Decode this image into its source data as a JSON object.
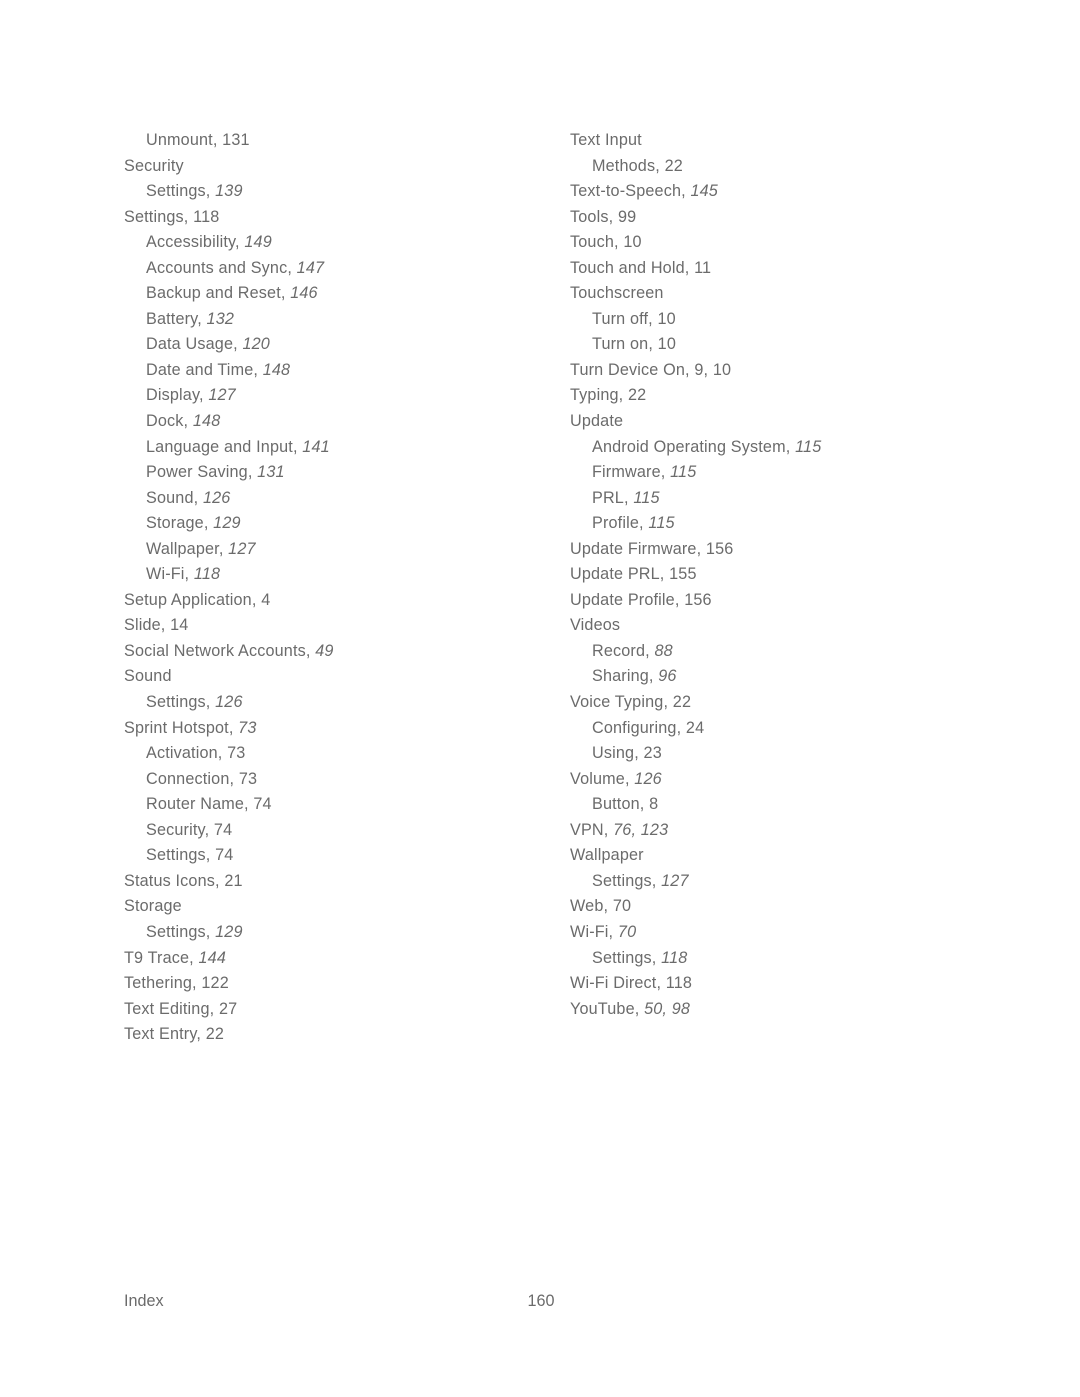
{
  "document": {
    "type": "book-index",
    "page_number": "160",
    "footer_label": "Index"
  },
  "columns": {
    "left": {
      "entries": [
        {
          "level": 1,
          "term": "Unmount,",
          "locator": "131",
          "italic": false
        },
        {
          "level": 0,
          "term": "Security",
          "locator": "",
          "italic": false
        },
        {
          "level": 1,
          "term": "Settings,",
          "locator": "139",
          "italic": true
        },
        {
          "level": 0,
          "term": "Settings,",
          "locator": "118",
          "italic": false
        },
        {
          "level": 1,
          "term": "Accessibility,",
          "locator": "149",
          "italic": true
        },
        {
          "level": 1,
          "term": "Accounts and Sync,",
          "locator": "147",
          "italic": true
        },
        {
          "level": 1,
          "term": "Backup and Reset,",
          "locator": "146",
          "italic": true
        },
        {
          "level": 1,
          "term": "Battery,",
          "locator": "132",
          "italic": true
        },
        {
          "level": 1,
          "term": "Data Usage,",
          "locator": "120",
          "italic": true
        },
        {
          "level": 1,
          "term": "Date and Time,",
          "locator": "148",
          "italic": true
        },
        {
          "level": 1,
          "term": "Display,",
          "locator": "127",
          "italic": true
        },
        {
          "level": 1,
          "term": "Dock,",
          "locator": "148",
          "italic": true
        },
        {
          "level": 1,
          "term": "Language and Input,",
          "locator": "141",
          "italic": true
        },
        {
          "level": 1,
          "term": "Power Saving,",
          "locator": "131",
          "italic": true
        },
        {
          "level": 1,
          "term": "Sound,",
          "locator": "126",
          "italic": true
        },
        {
          "level": 1,
          "term": "Storage,",
          "locator": "129",
          "italic": true
        },
        {
          "level": 1,
          "term": "Wallpaper,",
          "locator": "127",
          "italic": true
        },
        {
          "level": 1,
          "term": "Wi-Fi,",
          "locator": "118",
          "italic": true
        },
        {
          "level": 0,
          "term": "Setup Application,",
          "locator": "4",
          "italic": false
        },
        {
          "level": 0,
          "term": "Slide,",
          "locator": "14",
          "italic": false
        },
        {
          "level": 0,
          "term": "Social Network Accounts,",
          "locator": "49",
          "italic": true
        },
        {
          "level": 0,
          "term": "Sound",
          "locator": "",
          "italic": false
        },
        {
          "level": 1,
          "term": "Settings,",
          "locator": "126",
          "italic": true
        },
        {
          "level": 0,
          "term": "Sprint Hotspot,",
          "locator": "73",
          "italic": true
        },
        {
          "level": 1,
          "term": "Activation,",
          "locator": "73",
          "italic": false
        },
        {
          "level": 1,
          "term": "Connection,",
          "locator": "73",
          "italic": false
        },
        {
          "level": 1,
          "term": "Router Name,",
          "locator": "74",
          "italic": false
        },
        {
          "level": 1,
          "term": "Security,",
          "locator": "74",
          "italic": false
        },
        {
          "level": 1,
          "term": "Settings,",
          "locator": "74",
          "italic": false
        },
        {
          "level": 0,
          "term": "Status Icons,",
          "locator": "21",
          "italic": false
        },
        {
          "level": 0,
          "term": "Storage",
          "locator": "",
          "italic": false
        },
        {
          "level": 1,
          "term": "Settings,",
          "locator": "129",
          "italic": true
        },
        {
          "level": 0,
          "term": "T9 Trace,",
          "locator": "144",
          "italic": true
        },
        {
          "level": 0,
          "term": "Tethering,",
          "locator": "122",
          "italic": false
        },
        {
          "level": 0,
          "term": "Text Editing,",
          "locator": "27",
          "italic": false
        },
        {
          "level": 0,
          "term": "Text Entry,",
          "locator": "22",
          "italic": false
        }
      ]
    },
    "right": {
      "entries": [
        {
          "level": 0,
          "term": "Text Input",
          "locator": "",
          "italic": false
        },
        {
          "level": 1,
          "term": "Methods,",
          "locator": "22",
          "italic": false
        },
        {
          "level": 0,
          "term": "Text-to-Speech,",
          "locator": "145",
          "italic": true
        },
        {
          "level": 0,
          "term": "Tools,",
          "locator": "99",
          "italic": false
        },
        {
          "level": 0,
          "term": "Touch,",
          "locator": "10",
          "italic": false
        },
        {
          "level": 0,
          "term": "Touch and Hold,",
          "locator": "11",
          "italic": false
        },
        {
          "level": 0,
          "term": "Touchscreen",
          "locator": "",
          "italic": false
        },
        {
          "level": 1,
          "term": "Turn off,",
          "locator": "10",
          "italic": false
        },
        {
          "level": 1,
          "term": "Turn on,",
          "locator": "10",
          "italic": false
        },
        {
          "level": 0,
          "term": "Turn Device On,",
          "locator": "9, 10",
          "italic": false
        },
        {
          "level": 0,
          "term": "Typing,",
          "locator": "22",
          "italic": false
        },
        {
          "level": 0,
          "term": "Update",
          "locator": "",
          "italic": false
        },
        {
          "level": 1,
          "term": "Android Operating System,",
          "locator": "115",
          "italic": true
        },
        {
          "level": 1,
          "term": "Firmware,",
          "locator": "115",
          "italic": true
        },
        {
          "level": 1,
          "term": "PRL,",
          "locator": "115",
          "italic": true
        },
        {
          "level": 1,
          "term": "Profile,",
          "locator": "115",
          "italic": true
        },
        {
          "level": 0,
          "term": "Update Firmware,",
          "locator": "156",
          "italic": false
        },
        {
          "level": 0,
          "term": "Update PRL,",
          "locator": "155",
          "italic": false
        },
        {
          "level": 0,
          "term": "Update Profile,",
          "locator": "156",
          "italic": false
        },
        {
          "level": 0,
          "term": "Videos",
          "locator": "",
          "italic": false
        },
        {
          "level": 1,
          "term": "Record,",
          "locator": "88",
          "italic": true
        },
        {
          "level": 1,
          "term": "Sharing,",
          "locator": "96",
          "italic": true
        },
        {
          "level": 0,
          "term": "Voice Typing,",
          "locator": "22",
          "italic": false
        },
        {
          "level": 1,
          "term": "Configuring,",
          "locator": "24",
          "italic": false
        },
        {
          "level": 1,
          "term": "Using,",
          "locator": "23",
          "italic": false
        },
        {
          "level": 0,
          "term": "Volume,",
          "locator": "126",
          "italic": true
        },
        {
          "level": 1,
          "term": "Button,",
          "locator": "8",
          "italic": false
        },
        {
          "level": 0,
          "term": "VPN,",
          "locator": "76, 123",
          "italic": true
        },
        {
          "level": 0,
          "term": "Wallpaper",
          "locator": "",
          "italic": false
        },
        {
          "level": 1,
          "term": "Settings,",
          "locator": "127",
          "italic": true
        },
        {
          "level": 0,
          "term": "Web,",
          "locator": "70",
          "italic": false
        },
        {
          "level": 0,
          "term": "Wi-Fi,",
          "locator": "70",
          "italic": true
        },
        {
          "level": 1,
          "term": "Settings,",
          "locator": "118",
          "italic": true
        },
        {
          "level": 0,
          "term": "Wi-Fi Direct,",
          "locator": "118",
          "italic": false
        },
        {
          "level": 0,
          "term": "YouTube,",
          "locator": "50, 98",
          "italic": true
        }
      ]
    }
  }
}
